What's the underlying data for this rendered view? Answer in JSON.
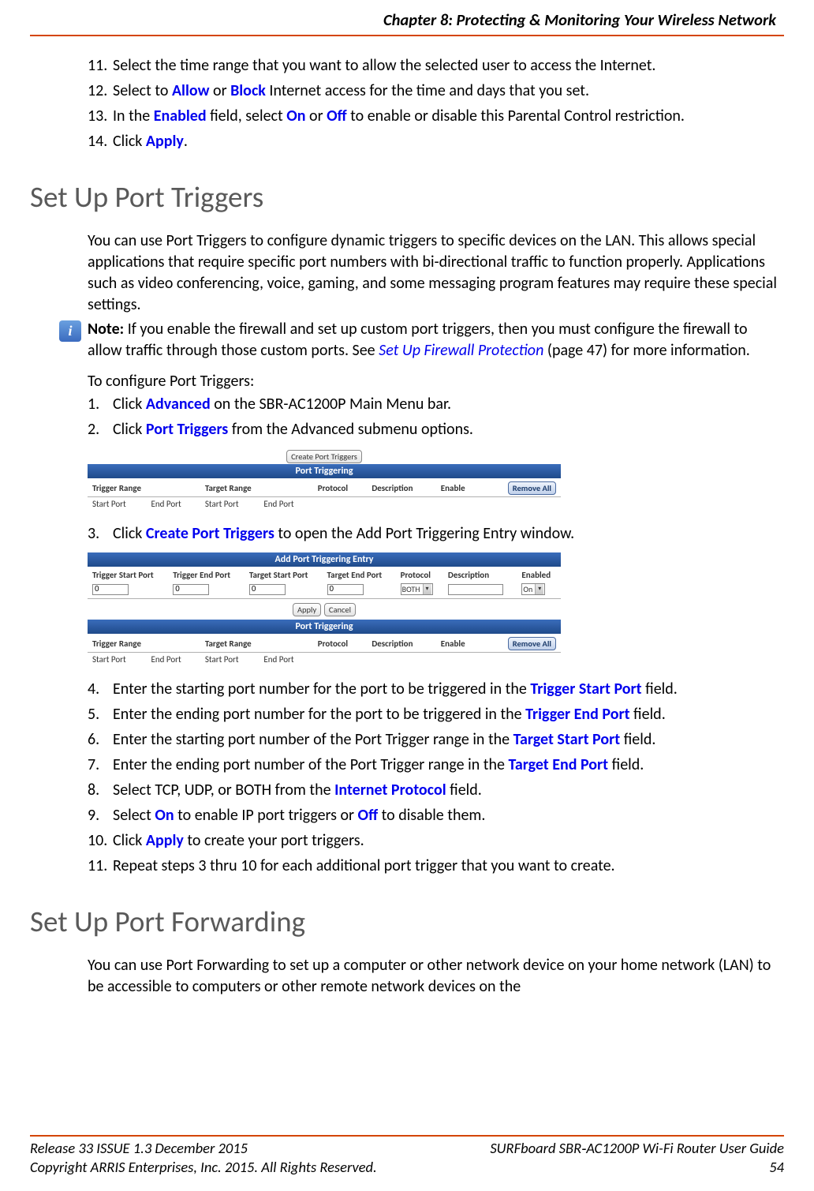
{
  "header": {
    "chapter": "Chapter 8: Protecting & Monitoring Your Wireless Network"
  },
  "top_steps": [
    {
      "num": "11.",
      "parts": [
        {
          "t": "Select the time range that you want to allow the selected user to access the Internet."
        }
      ]
    },
    {
      "num": "12.",
      "parts": [
        {
          "t": "Select to "
        },
        {
          "t": "Allow",
          "b": true
        },
        {
          "t": " or "
        },
        {
          "t": "Block",
          "b": true
        },
        {
          "t": " Internet access for the time and days that you set."
        }
      ]
    },
    {
      "num": "13.",
      "parts": [
        {
          "t": "In the "
        },
        {
          "t": "Enabled",
          "b": true
        },
        {
          "t": " field, select "
        },
        {
          "t": "On",
          "b": true
        },
        {
          "t": " or "
        },
        {
          "t": "Off",
          "b": true
        },
        {
          "t": " to enable or disable this Parental Control restriction."
        }
      ]
    },
    {
      "num": "14.",
      "parts": [
        {
          "t": "Click "
        },
        {
          "t": "Apply",
          "b": true
        },
        {
          "t": "."
        }
      ]
    }
  ],
  "section1": {
    "title": "Set Up Port Triggers",
    "intro": "You can use Port Triggers to configure dynamic triggers to specific devices on the LAN. This allows special applications that require specific port numbers with bi-directional traffic to function properly. Applications such as video conferencing, voice, gaming, and some messaging program features may require these special settings.",
    "note_prefix": "Note:",
    "note_body1": " If you enable the firewall and set up custom port triggers, then you must configure the firewall to allow traffic through those custom ports. See ",
    "note_link": "Set Up Firewall Protection",
    "note_body2": " (page 47) for more information.",
    "config_lead": "To configure Port Triggers:",
    "steps_a": [
      {
        "num": "1.",
        "parts": [
          {
            "t": "Click "
          },
          {
            "t": "Advanced",
            "b": true
          },
          {
            "t": " on the SBR-AC1200P Main Menu bar."
          }
        ]
      },
      {
        "num": "2.",
        "parts": [
          {
            "t": "Click "
          },
          {
            "t": "Port Triggers",
            "b": true
          },
          {
            "t": " from the Advanced submenu options."
          }
        ]
      }
    ],
    "step3": {
      "num": "3.",
      "parts": [
        {
          "t": "Click "
        },
        {
          "t": "Create Port Triggers",
          "b": true
        },
        {
          "t": " to open the Add Port Triggering Entry window."
        }
      ]
    },
    "steps_b": [
      {
        "num": "4.",
        "parts": [
          {
            "t": "Enter the starting port number for the port to be triggered in the "
          },
          {
            "t": "Trigger Start Port",
            "b": true
          },
          {
            "t": " field."
          }
        ]
      },
      {
        "num": "5.",
        "parts": [
          {
            "t": "Enter the ending port number for the port to be triggered in the "
          },
          {
            "t": "Trigger End Port",
            "b": true
          },
          {
            "t": " field."
          }
        ]
      },
      {
        "num": "6.",
        "parts": [
          {
            "t": "Enter the starting port number of the Port Trigger range in the "
          },
          {
            "t": "Target Start Port",
            "b": true
          },
          {
            "t": " field."
          }
        ]
      },
      {
        "num": "7.",
        "parts": [
          {
            "t": "Enter the ending port number of the Port Trigger range in the "
          },
          {
            "t": "Target End Port",
            "b": true
          },
          {
            "t": " field."
          }
        ]
      },
      {
        "num": "8.",
        "parts": [
          {
            "t": "Select TCP, UDP, or BOTH from the "
          },
          {
            "t": "Internet Protocol",
            "b": true
          },
          {
            "t": " field."
          }
        ]
      },
      {
        "num": "9.",
        "parts": [
          {
            "t": "Select "
          },
          {
            "t": "On",
            "b": true
          },
          {
            "t": " to enable IP port triggers or "
          },
          {
            "t": "Off",
            "b": true
          },
          {
            "t": " to disable them."
          }
        ]
      },
      {
        "num": "10.",
        "parts": [
          {
            "t": "Click "
          },
          {
            "t": "Apply",
            "b": true
          },
          {
            "t": " to create your port triggers."
          }
        ]
      },
      {
        "num": "11.",
        "parts": [
          {
            "t": "Repeat steps 3 thru 10 for each additional port trigger that you want to create."
          }
        ]
      }
    ]
  },
  "figure1": {
    "create_btn": "Create Port Triggers",
    "band": "Port Triggering",
    "head1": [
      "Trigger Range",
      "Target Range",
      "Protocol",
      "Description",
      "Enable"
    ],
    "remove_all": "Remove All",
    "sub1": [
      "Start Port",
      "End Port",
      "Start Port",
      "End Port"
    ]
  },
  "figure2": {
    "band1": "Add Port Triggering Entry",
    "head1": [
      "Trigger Start Port",
      "Trigger End Port",
      "Target Start Port",
      "Target End Port",
      "Protocol",
      "Description",
      "Enabled"
    ],
    "inputs": {
      "v1": "0",
      "v2": "0",
      "v3": "0",
      "v4": "0"
    },
    "proto": "BOTH",
    "enabled": "On",
    "apply": "Apply",
    "cancel": "Cancel",
    "band2": "Port Triggering",
    "head2": [
      "Trigger Range",
      "Target Range",
      "Protocol",
      "Description",
      "Enable"
    ],
    "remove_all": "Remove All",
    "sub2": [
      "Start Port",
      "End Port",
      "Start Port",
      "End Port"
    ]
  },
  "section2": {
    "title": "Set Up Port Forwarding",
    "intro": "You can use Port Forwarding to set up a computer or other network device on your home network (LAN) to be accessible to computers or other remote network devices on the"
  },
  "footer": {
    "left1": "Release 33 ISSUE 1.3    December 2015",
    "left2": "Copyright ARRIS Enterprises, Inc. 2015. All Rights Reserved.",
    "right1": "SURFboard SBR‑AC1200P Wi-Fi Router User Guide",
    "right2": "54"
  }
}
